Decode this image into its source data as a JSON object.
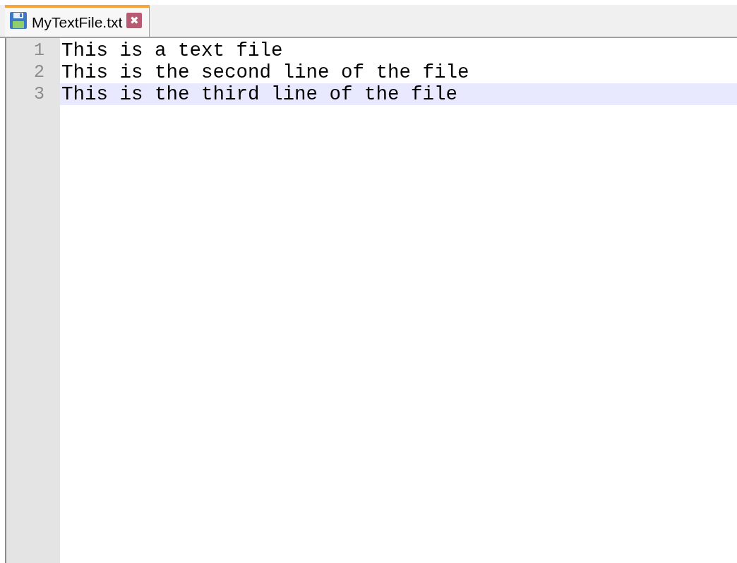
{
  "tabs": [
    {
      "label": "MyTextFile.txt",
      "selected": true,
      "close": "✖"
    }
  ],
  "editor": {
    "lines": [
      {
        "number": "1",
        "text": "This is a text file",
        "selected": false
      },
      {
        "number": "2",
        "text": "This is the second line of the file",
        "selected": false
      },
      {
        "number": "3",
        "text": "This is the third line of the file",
        "selected": true
      }
    ]
  }
}
